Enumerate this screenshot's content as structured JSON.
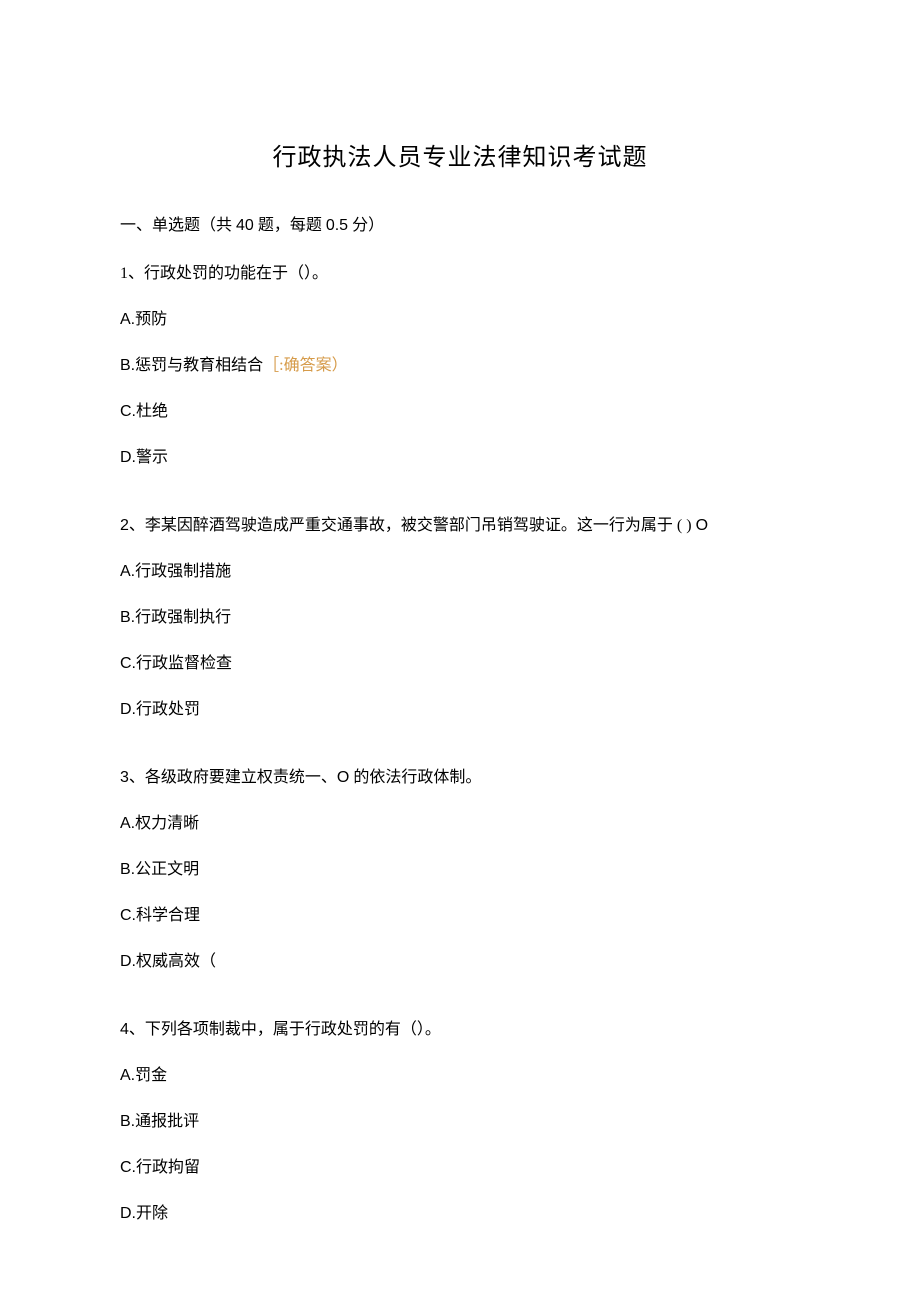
{
  "title": "行政执法人员专业法律知识考试题",
  "section_header_prefix": "一、单选题（共 ",
  "section_header_qcount": "40",
  "section_header_mid": " 题，每题 ",
  "section_header_pts": "0.5",
  "section_header_suffix": " 分）",
  "q1": {
    "text": "1、行政处罚的功能在于（）。",
    "A_label": "A.",
    "A": "预防",
    "B_label": "B.",
    "B": "惩罚与教育相结合",
    "B_mark": "［:确答案）",
    "C_label": "C.",
    "C": "杜绝",
    "D_label": "D.",
    "D": "警示"
  },
  "q2": {
    "num": "2",
    "text_after_num": "、李某因醉酒驾驶造成严重交通事故，被交警部门吊销驾驶证。这一行为属于 ( ) ",
    "trail": "O",
    "A_label": "A.",
    "A": "行政强制措施",
    "B_label": "B.",
    "B": "行政强制执行",
    "C_label": "C.",
    "C": "行政监督检查",
    "D_label": "D.",
    "D": "行政处罚"
  },
  "q3": {
    "num": "3",
    "text_after_num_a": "、各级政府要建立权责统一、",
    "text_glyph": "O",
    "text_after_num_b": " 的依法行政体制。",
    "A_label": "A.",
    "A": "权力清晰",
    "B_label": "B.",
    "B": "公正文明",
    "C_label": "C.",
    "C": "科学合理",
    "D_label": "D.",
    "D": "权威高效（"
  },
  "q4": {
    "num": "4",
    "text_after_num": "、下列各项制裁中，属于行政处罚的有（）。",
    "A_label": "A.",
    "A": "罚金",
    "B_label": "B.",
    "B": "通报批评",
    "C_label": "C.",
    "C": "行政拘留",
    "D_label": "D.",
    "D": "开除"
  }
}
